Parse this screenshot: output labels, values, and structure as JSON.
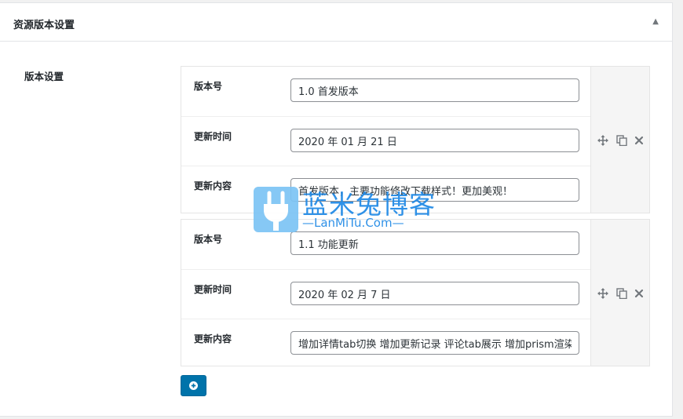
{
  "panel": {
    "title": "资源版本设置",
    "section_label": "版本设置"
  },
  "groups": [
    {
      "rows": [
        {
          "label": "版本号",
          "value": "1.0 首发版本"
        },
        {
          "label": "更新时间",
          "value": "2020 年 01 月 21 日"
        },
        {
          "label": "更新内容",
          "value": "首发版本，主要功能修改下载样式！更加美观！"
        }
      ]
    },
    {
      "rows": [
        {
          "label": "版本号",
          "value": "1.1 功能更新"
        },
        {
          "label": "更新时间",
          "value": "2020 年 02 月 7 日"
        },
        {
          "label": "更新内容",
          "value": "增加详情tab切换 增加更新记录 评论tab展示 增加prism渲染"
        }
      ]
    }
  ],
  "icons": {
    "collapse": "triangle-up-icon",
    "move": "move-icon",
    "copy": "copy-icon",
    "delete": "close-icon",
    "add": "plus-circle-icon"
  },
  "colors": {
    "accent": "#0073aa",
    "watermark": "#1e88e5"
  },
  "watermark": {
    "title": "蓝米兔博客",
    "subtitle": "—LanMiTu.Com—"
  }
}
